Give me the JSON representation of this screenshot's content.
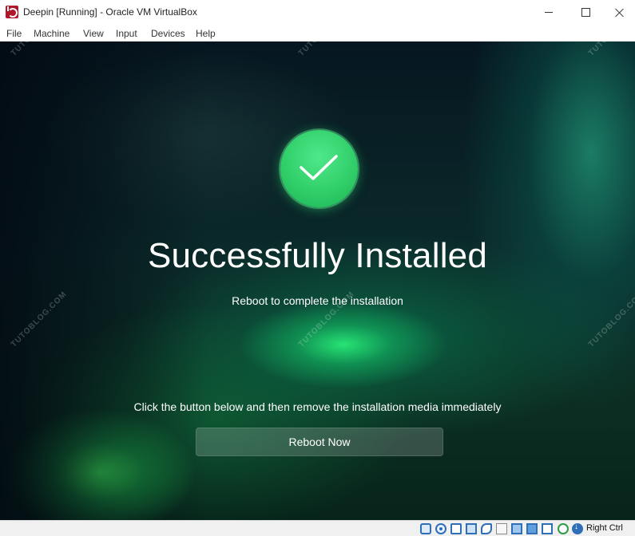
{
  "window": {
    "title": "Deepin [Running] - Oracle VM VirtualBox"
  },
  "menu": {
    "items": [
      "File",
      "Machine",
      "View",
      "Input",
      "Devices",
      "Help"
    ]
  },
  "installer": {
    "status_icon": "checkmark-icon",
    "heading": "Successfully Installed",
    "subheading": "Reboot to complete the installation",
    "instruction": "Click the button below and then remove the installation media immediately",
    "reboot_button": "Reboot Now"
  },
  "watermark": {
    "text": "TUTOBLOG.COM"
  },
  "statusbar": {
    "icons": [
      "hard-disk-icon",
      "optical-drive-icon",
      "audio-icon",
      "network-icon",
      "usb-icon",
      "shared-folders-icon",
      "display-icon",
      "recording-icon",
      "virtualization-icon",
      "mouse-integration-icon",
      "keyboard-capture-icon"
    ],
    "host_key": "Right Ctrl"
  },
  "colors": {
    "success_green": "#31cf6a",
    "vbox_blue": "#2f6fb8"
  }
}
